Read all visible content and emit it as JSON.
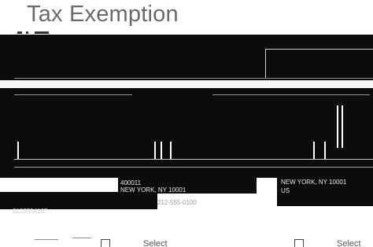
{
  "page": {
    "title": "Tax Exemption"
  },
  "address_one": {
    "line1": "400011",
    "line2": "NEW YORK, NY 10001",
    "phone": "212-555-0100"
  },
  "address_two": {
    "city_state": "NEW YORK, NY 10001",
    "code": "US"
  },
  "account_id": "2123554107",
  "options": [
    {
      "label": "Select"
    },
    {
      "label": "Select"
    }
  ]
}
